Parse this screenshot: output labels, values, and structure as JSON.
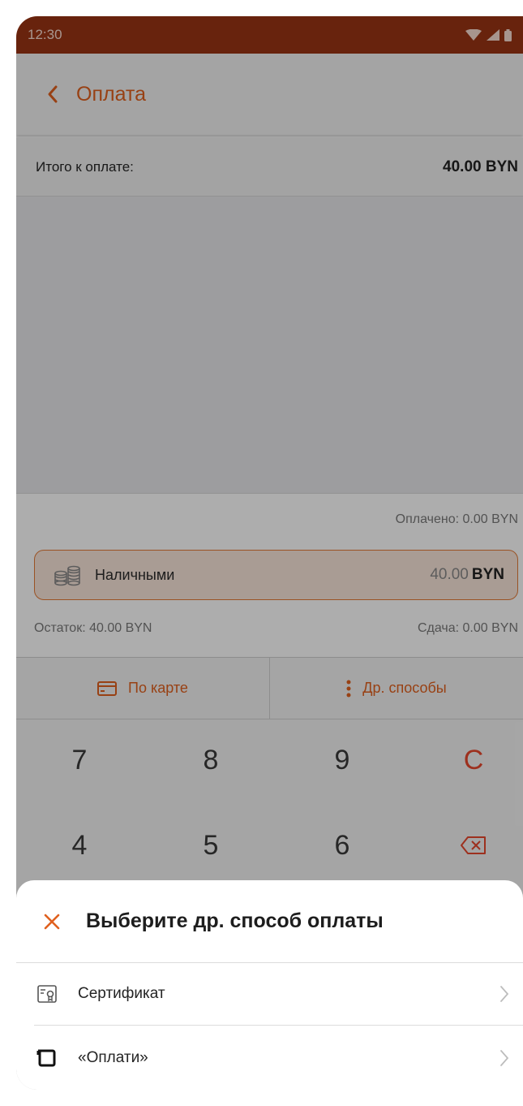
{
  "status_bar": {
    "time": "12:30"
  },
  "app_bar": {
    "title": "Оплата"
  },
  "summary": {
    "total_label": "Итого к оплате:",
    "total_value": "40.00 BYN",
    "paid": "Оплачено: 0.00 BYN",
    "rest": "Остаток: 40.00 BYN",
    "change": "Сдача: 0.00 BYN"
  },
  "cash": {
    "label": "Наличными",
    "amount": "40.00",
    "currency": "BYN"
  },
  "pay_buttons": {
    "card": "По карте",
    "other": "Др. способы"
  },
  "keypad": {
    "keys": [
      "7",
      "8",
      "9",
      "C",
      "4",
      "5",
      "6"
    ]
  },
  "sheet": {
    "title": "Выберите др. способ оплаты",
    "items": [
      {
        "label": "Сертификат",
        "icon": "certificate-icon"
      },
      {
        "label": "«Оплати»",
        "icon": "oplati-icon"
      }
    ]
  },
  "colors": {
    "accent": "#e0601e",
    "status_bar": "#9a3414",
    "clear_key": "#e8482d"
  }
}
